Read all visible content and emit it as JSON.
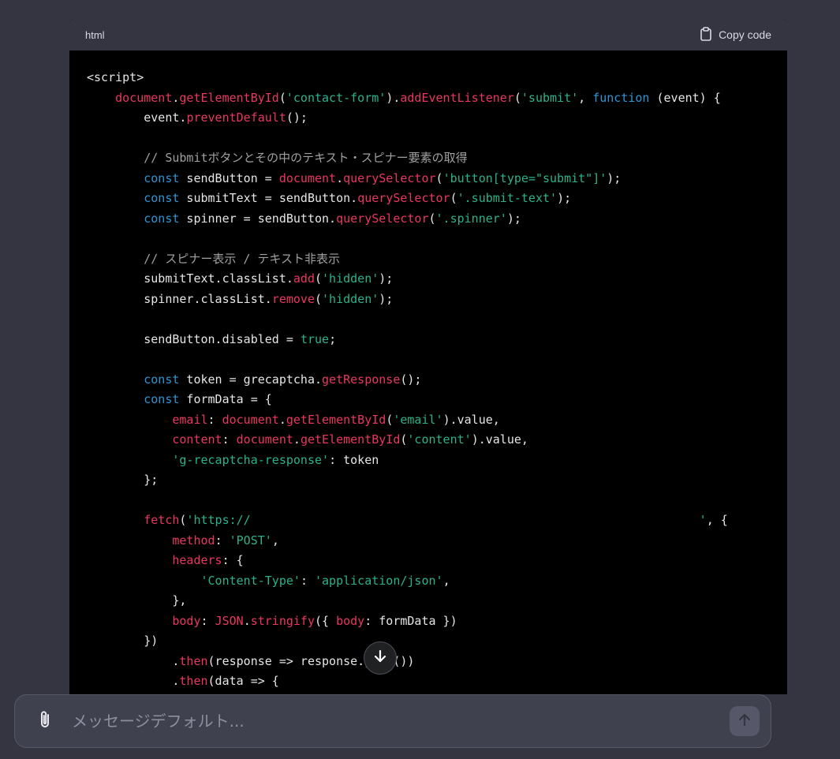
{
  "code_block": {
    "language": "html",
    "copy_label": "Copy code",
    "lines": [
      [
        {
          "c": "t-plain",
          "t": "<script>"
        }
      ],
      [
        {
          "c": "t-plain",
          "t": "    "
        },
        {
          "c": "t-call",
          "t": "document"
        },
        {
          "c": "t-plain",
          "t": "."
        },
        {
          "c": "t-call",
          "t": "getElementById"
        },
        {
          "c": "t-plain",
          "t": "("
        },
        {
          "c": "t-str",
          "t": "'contact-form'"
        },
        {
          "c": "t-plain",
          "t": ")."
        },
        {
          "c": "t-call",
          "t": "addEventListener"
        },
        {
          "c": "t-plain",
          "t": "("
        },
        {
          "c": "t-str",
          "t": "'submit'"
        },
        {
          "c": "t-plain",
          "t": ", "
        },
        {
          "c": "t-kw",
          "t": "function"
        },
        {
          "c": "t-plain",
          "t": " (event) {"
        }
      ],
      [
        {
          "c": "t-plain",
          "t": "        event."
        },
        {
          "c": "t-call",
          "t": "preventDefault"
        },
        {
          "c": "t-plain",
          "t": "();"
        }
      ],
      [
        {
          "c": "t-plain",
          "t": ""
        }
      ],
      [
        {
          "c": "t-plain",
          "t": "        "
        },
        {
          "c": "t-com",
          "t": "// Submitボタンとその中のテキスト・スピナー要素の取得"
        }
      ],
      [
        {
          "c": "t-plain",
          "t": "        "
        },
        {
          "c": "t-kw",
          "t": "const"
        },
        {
          "c": "t-plain",
          "t": " sendButton = "
        },
        {
          "c": "t-call",
          "t": "document"
        },
        {
          "c": "t-plain",
          "t": "."
        },
        {
          "c": "t-call",
          "t": "querySelector"
        },
        {
          "c": "t-plain",
          "t": "("
        },
        {
          "c": "t-str",
          "t": "'button[type=\"submit\"]'"
        },
        {
          "c": "t-plain",
          "t": ");"
        }
      ],
      [
        {
          "c": "t-plain",
          "t": "        "
        },
        {
          "c": "t-kw",
          "t": "const"
        },
        {
          "c": "t-plain",
          "t": " submitText = sendButton."
        },
        {
          "c": "t-call",
          "t": "querySelector"
        },
        {
          "c": "t-plain",
          "t": "("
        },
        {
          "c": "t-str",
          "t": "'.submit-text'"
        },
        {
          "c": "t-plain",
          "t": ");"
        }
      ],
      [
        {
          "c": "t-plain",
          "t": "        "
        },
        {
          "c": "t-kw",
          "t": "const"
        },
        {
          "c": "t-plain",
          "t": " spinner = sendButton."
        },
        {
          "c": "t-call",
          "t": "querySelector"
        },
        {
          "c": "t-plain",
          "t": "("
        },
        {
          "c": "t-str",
          "t": "'.spinner'"
        },
        {
          "c": "t-plain",
          "t": ");"
        }
      ],
      [
        {
          "c": "t-plain",
          "t": ""
        }
      ],
      [
        {
          "c": "t-plain",
          "t": "        "
        },
        {
          "c": "t-com",
          "t": "// スピナー表示 / テキスト非表示"
        }
      ],
      [
        {
          "c": "t-plain",
          "t": "        submitText.classList."
        },
        {
          "c": "t-call",
          "t": "add"
        },
        {
          "c": "t-plain",
          "t": "("
        },
        {
          "c": "t-str",
          "t": "'hidden'"
        },
        {
          "c": "t-plain",
          "t": ");"
        }
      ],
      [
        {
          "c": "t-plain",
          "t": "        spinner.classList."
        },
        {
          "c": "t-call",
          "t": "remove"
        },
        {
          "c": "t-plain",
          "t": "("
        },
        {
          "c": "t-str",
          "t": "'hidden'"
        },
        {
          "c": "t-plain",
          "t": ");"
        }
      ],
      [
        {
          "c": "t-plain",
          "t": ""
        }
      ],
      [
        {
          "c": "t-plain",
          "t": "        sendButton.disabled = "
        },
        {
          "c": "t-str",
          "t": "true"
        },
        {
          "c": "t-plain",
          "t": ";"
        }
      ],
      [
        {
          "c": "t-plain",
          "t": ""
        }
      ],
      [
        {
          "c": "t-plain",
          "t": "        "
        },
        {
          "c": "t-kw",
          "t": "const"
        },
        {
          "c": "t-plain",
          "t": " token = grecaptcha."
        },
        {
          "c": "t-call",
          "t": "getResponse"
        },
        {
          "c": "t-plain",
          "t": "();"
        }
      ],
      [
        {
          "c": "t-plain",
          "t": "        "
        },
        {
          "c": "t-kw",
          "t": "const"
        },
        {
          "c": "t-plain",
          "t": " formData = {"
        }
      ],
      [
        {
          "c": "t-plain",
          "t": "            "
        },
        {
          "c": "t-prop",
          "t": "email"
        },
        {
          "c": "t-plain",
          "t": ": "
        },
        {
          "c": "t-call",
          "t": "document"
        },
        {
          "c": "t-plain",
          "t": "."
        },
        {
          "c": "t-call",
          "t": "getElementById"
        },
        {
          "c": "t-plain",
          "t": "("
        },
        {
          "c": "t-str",
          "t": "'email'"
        },
        {
          "c": "t-plain",
          "t": ").value,"
        }
      ],
      [
        {
          "c": "t-plain",
          "t": "            "
        },
        {
          "c": "t-prop",
          "t": "content"
        },
        {
          "c": "t-plain",
          "t": ": "
        },
        {
          "c": "t-call",
          "t": "document"
        },
        {
          "c": "t-plain",
          "t": "."
        },
        {
          "c": "t-call",
          "t": "getElementById"
        },
        {
          "c": "t-plain",
          "t": "("
        },
        {
          "c": "t-str",
          "t": "'content'"
        },
        {
          "c": "t-plain",
          "t": ").value,"
        }
      ],
      [
        {
          "c": "t-plain",
          "t": "            "
        },
        {
          "c": "t-str",
          "t": "'g-recaptcha-response'"
        },
        {
          "c": "t-plain",
          "t": ": token"
        }
      ],
      [
        {
          "c": "t-plain",
          "t": "        };"
        }
      ],
      [
        {
          "c": "t-plain",
          "t": ""
        }
      ],
      [
        {
          "c": "t-plain",
          "t": "        "
        },
        {
          "c": "t-call",
          "t": "fetch"
        },
        {
          "c": "t-plain",
          "t": "("
        },
        {
          "c": "t-str",
          "t": "'https://                                                               '"
        },
        {
          "c": "t-plain",
          "t": ", {"
        }
      ],
      [
        {
          "c": "t-plain",
          "t": "            "
        },
        {
          "c": "t-prop",
          "t": "method"
        },
        {
          "c": "t-plain",
          "t": ": "
        },
        {
          "c": "t-str",
          "t": "'POST'"
        },
        {
          "c": "t-plain",
          "t": ","
        }
      ],
      [
        {
          "c": "t-plain",
          "t": "            "
        },
        {
          "c": "t-prop",
          "t": "headers"
        },
        {
          "c": "t-plain",
          "t": ": {"
        }
      ],
      [
        {
          "c": "t-plain",
          "t": "                "
        },
        {
          "c": "t-str",
          "t": "'Content-Type'"
        },
        {
          "c": "t-plain",
          "t": ": "
        },
        {
          "c": "t-str",
          "t": "'application/json'"
        },
        {
          "c": "t-plain",
          "t": ","
        }
      ],
      [
        {
          "c": "t-plain",
          "t": "            },"
        }
      ],
      [
        {
          "c": "t-plain",
          "t": "            "
        },
        {
          "c": "t-prop",
          "t": "body"
        },
        {
          "c": "t-plain",
          "t": ": "
        },
        {
          "c": "t-call",
          "t": "JSON"
        },
        {
          "c": "t-plain",
          "t": "."
        },
        {
          "c": "t-call",
          "t": "stringify"
        },
        {
          "c": "t-plain",
          "t": "({ "
        },
        {
          "c": "t-prop",
          "t": "body"
        },
        {
          "c": "t-plain",
          "t": ": formData })"
        }
      ],
      [
        {
          "c": "t-plain",
          "t": "        })"
        }
      ],
      [
        {
          "c": "t-plain",
          "t": "            ."
        },
        {
          "c": "t-call",
          "t": "then"
        },
        {
          "c": "t-plain",
          "t": "(response => response."
        },
        {
          "c": "t-call",
          "t": "json"
        },
        {
          "c": "t-plain",
          "t": "())"
        }
      ],
      [
        {
          "c": "t-plain",
          "t": "            ."
        },
        {
          "c": "t-call",
          "t": "then"
        },
        {
          "c": "t-plain",
          "t": "(data => {"
        }
      ]
    ]
  },
  "composer": {
    "placeholder": "メッセージデフォルト..."
  },
  "icons": {
    "copy": "clipboard-icon",
    "scroll": "arrow-down-icon",
    "attach": "paperclip-icon",
    "send": "arrow-up-icon"
  }
}
